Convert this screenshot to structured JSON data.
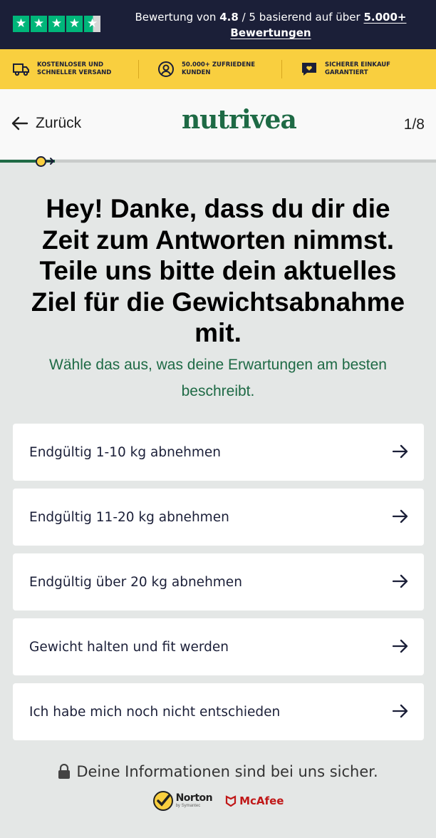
{
  "rating_bar": {
    "stars_count": 5,
    "rating_prefix": "Bewertung von",
    "rating_value": "4.8",
    "rating_mid": "/ 5 basierend auf über",
    "review_count": "5.000+",
    "reviews_link": "Bewertungen",
    "colors": {
      "background": "#1b1f38",
      "star": "#00b67a"
    }
  },
  "benefits": [
    {
      "icon": "truck-icon",
      "line1": "KOSTENLOSER UND",
      "line2": "SCHNELLER VERSAND"
    },
    {
      "icon": "user-circle-icon",
      "line1": "50.000+ ZUFRIEDENE",
      "line2": "KUNDEN"
    },
    {
      "icon": "heart-chat-icon",
      "line1": "SICHERER EINKAUF",
      "line2": "GARANTIERT"
    }
  ],
  "header": {
    "back_label": "Zurück",
    "logo_text": "nutrivea",
    "step_indicator": "1/8"
  },
  "progress": {
    "current_step": 1,
    "total_steps": 8,
    "fraction": 0.125
  },
  "question": {
    "title": "Hey! Danke, dass du dir die Zeit zum Antworten nimmst. Teile uns bitte dein aktuelles Ziel für die Gewichtsabnahme mit.",
    "subtitle": "Wähle das aus, was deine Erwartungen am besten beschreibt."
  },
  "options": [
    {
      "label": "Endgültig 1-10 kg abnehmen"
    },
    {
      "label": "Endgültig 11-20 kg abnehmen"
    },
    {
      "label": "Endgültig über 20 kg abnehmen"
    },
    {
      "label": "Gewicht halten und fit werden"
    },
    {
      "label": "Ich habe mich noch nicht entschieden"
    }
  ],
  "footer": {
    "secure_text": "Deine Informationen sind bei uns sicher.",
    "norton_name": "Norton",
    "norton_sub": "by Symantec",
    "mcafee_name": "McAfee"
  },
  "colors": {
    "brand_green": "#1e6a45",
    "accent_yellow": "#f9cf3f",
    "navy": "#1b1f38",
    "page_bg": "#e4e7e6"
  }
}
